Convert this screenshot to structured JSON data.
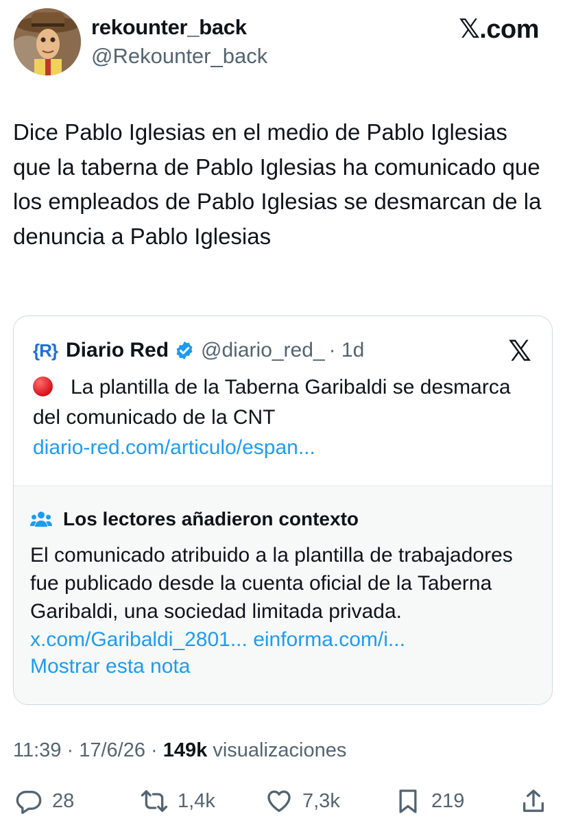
{
  "author": {
    "display_name": "rekounter_back",
    "handle": "@Rekounter_back",
    "avatar_icon": "avatar-cowboy-icon"
  },
  "brand": "𝕏.com",
  "tweet": {
    "text": "Dice Pablo Iglesias en el medio de Pablo Iglesias que la taberna de Pablo Iglesias ha comunicado que los empleados de Pablo Iglesias se desmarcan de la denuncia a Pablo Iglesias"
  },
  "quote": {
    "logo": "{R}",
    "name": "Diario Red",
    "handle": "@diario_red_",
    "time": "· 1d",
    "text": "La plantilla de la Taberna Garibaldi se desmarca del comunicado de la CNT",
    "link": "diario-red.com/articulo/espan...",
    "x_logo": "𝕏"
  },
  "community_note": {
    "title": "Los lectores añadieron contexto",
    "body": "El comunicado atribuido a la plantilla de trabajadores fue publicado desde la cuenta oficial de la Taberna Garibaldi, una sociedad limitada privada.",
    "link1": "x.com/Garibaldi_2801...",
    "link2": "einforma.com/i...",
    "show_label": "Mostrar esta nota"
  },
  "meta": {
    "time_date": "11:39 · 17/6/26 ·",
    "views": "149k",
    "views_label": "visualizaciones"
  },
  "actions": {
    "replies": "28",
    "reposts": "1,4k",
    "likes": "7,3k",
    "bookmarks": "219"
  },
  "colors": {
    "link": "#1d9bf0",
    "secondary_text": "#536471",
    "verified": "#1d9bf0",
    "note_bg": "#f7f9f9"
  }
}
